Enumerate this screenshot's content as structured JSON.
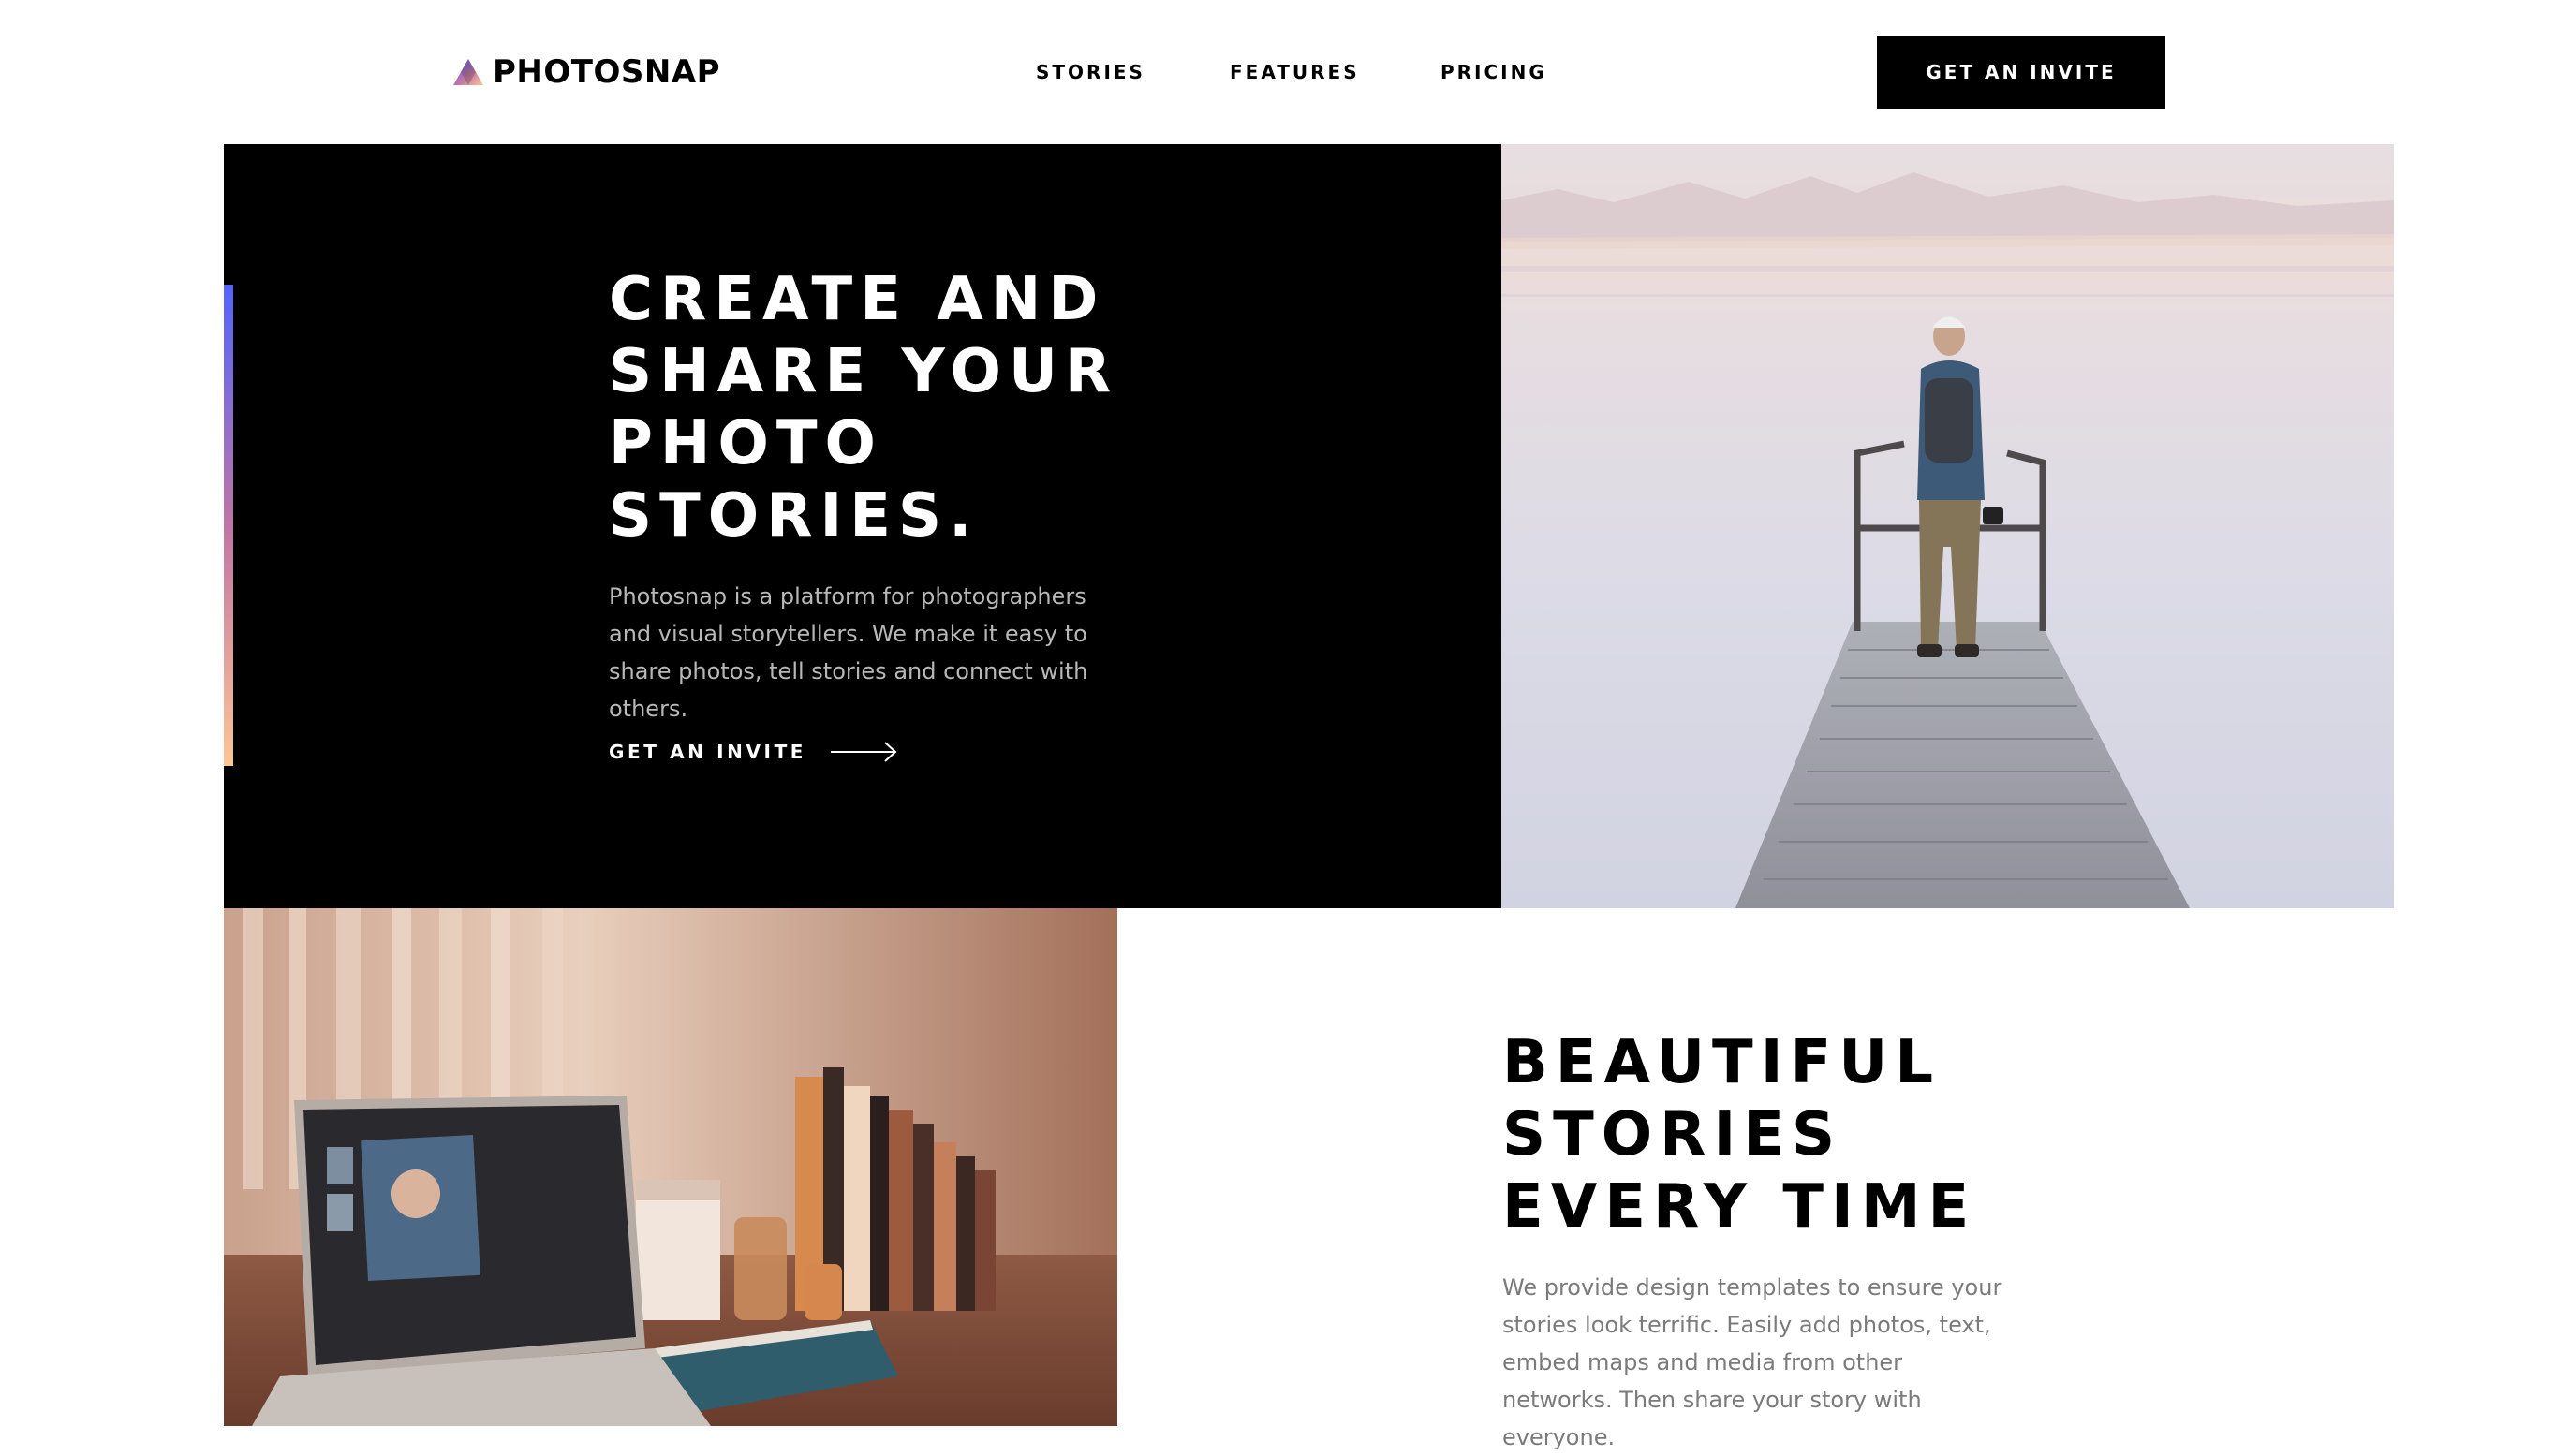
{
  "header": {
    "logo_text": "PHOTOSNAP",
    "nav": [
      {
        "label": "STORIES"
      },
      {
        "label": "FEATURES"
      },
      {
        "label": "PRICING"
      }
    ],
    "cta_label": "GET AN INVITE"
  },
  "hero": {
    "title_lines": [
      "CREATE AND",
      "SHARE YOUR",
      "PHOTO",
      "STORIES."
    ],
    "description": "Photosnap is a platform for photographers and visual storytellers. We make it easy to share photos, tell stories and connect with others.",
    "cta_label": "GET AN INVITE",
    "accent_colors": [
      "#5165ff",
      "#c174a6",
      "#ffc593"
    ]
  },
  "section2": {
    "title_lines": [
      "BEAUTIFUL",
      "STORIES",
      "EVERY TIME"
    ],
    "description": "We provide design templates to ensure your stories look terrific. Easily add photos, text, embed maps and media from other networks. Then share your story with everyone."
  },
  "icons": {
    "logo": "photosnap-triangle-icon",
    "cta_arrow": "arrow-right-icon"
  }
}
